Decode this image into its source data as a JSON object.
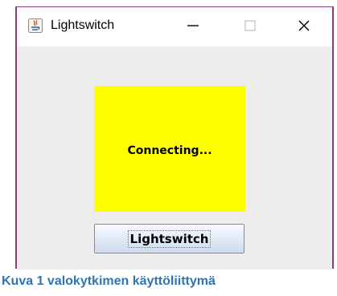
{
  "window": {
    "title": "Lightswitch",
    "controls": {
      "minimize": "minimize-icon",
      "maximize": "maximize-icon",
      "close": "close-icon"
    }
  },
  "status_panel": {
    "text": "Connecting...",
    "color": "#ffff00"
  },
  "toggle_button": {
    "label": "Lightswitch"
  },
  "caption": {
    "text": "Kuva 1 valokytkimen käyttöliittymä",
    "color": "#2e74b5"
  },
  "colors": {
    "window_border": "#8a3d7a",
    "window_background": "#ededed"
  }
}
